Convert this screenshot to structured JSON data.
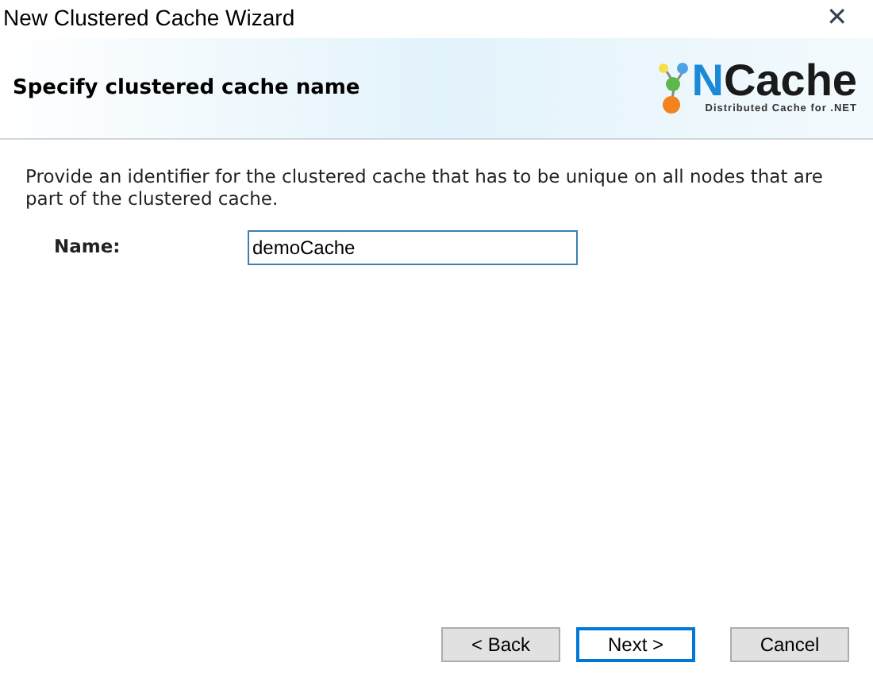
{
  "window": {
    "title": "New Clustered Cache Wizard",
    "close": "✕"
  },
  "header": {
    "title": "Specify clustered cache name",
    "logo": {
      "wordmark": "NCache",
      "tagline": "Distributed Cache for .NET"
    }
  },
  "description": "Provide an identifier for the clustered cache that has to be unique on all nodes that are part of the clustered cache.",
  "name_field": {
    "label": "Name:",
    "value": "demoCache"
  },
  "buttons": [
    {
      "label": "< Back",
      "default": false
    },
    {
      "label": "Next >",
      "default": true
    },
    {
      "label": "Cancel",
      "default": false
    }
  ]
}
